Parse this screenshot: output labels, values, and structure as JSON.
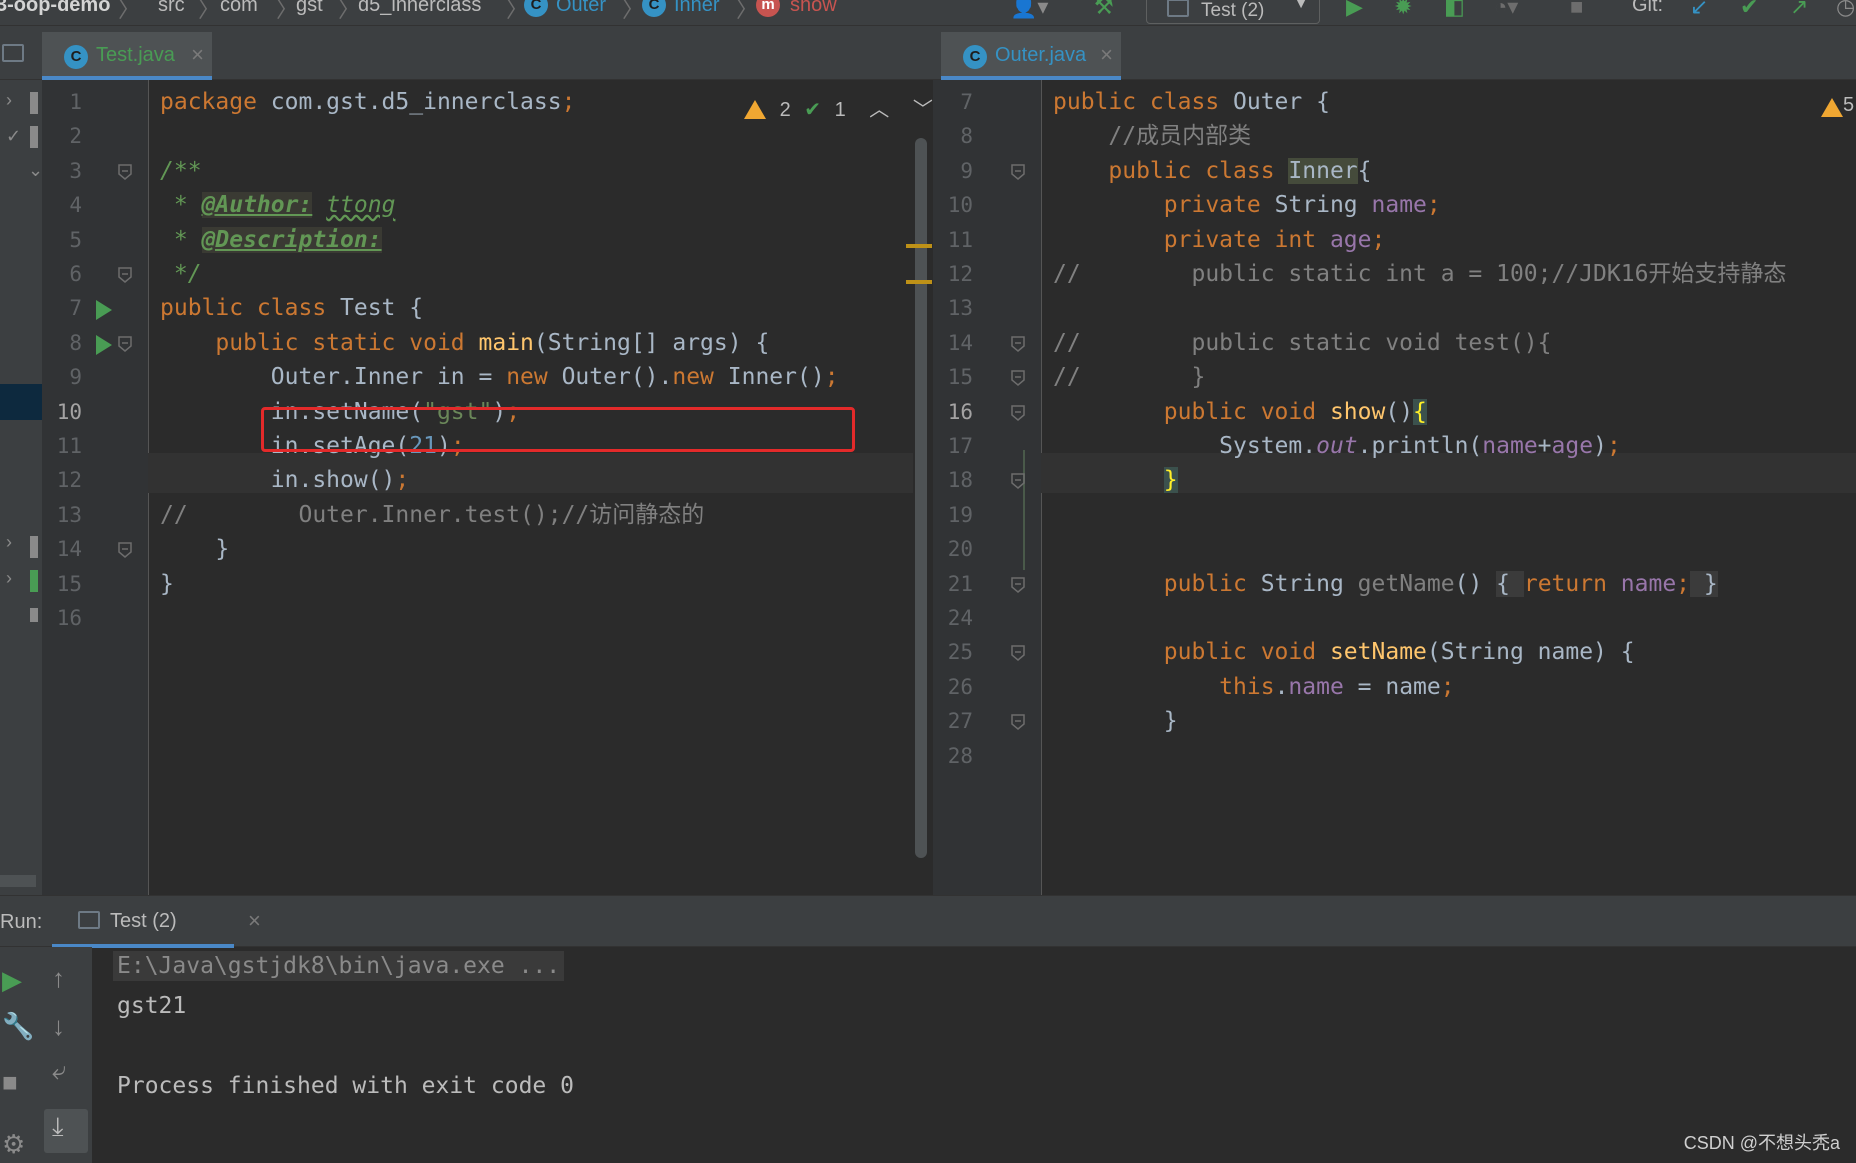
{
  "breadcrumbs": [
    "3-oop-demo",
    "src",
    "com",
    "gst",
    "d5_innerclass",
    "Outer",
    "Inner",
    "show"
  ],
  "toolbar": {
    "run_config": "Test (2)",
    "git_label": "Git:"
  },
  "left_tab": {
    "filename": "Test.java"
  },
  "right_tab": {
    "filename": "Outer.java"
  },
  "inspection": {
    "warnings": "2",
    "ok": "1"
  },
  "right_warnings": "5",
  "left_editor": {
    "line_numbers": [
      "1",
      "2",
      "3",
      "4",
      "5",
      "6",
      "7",
      "8",
      "9",
      "10",
      "11",
      "12",
      "13",
      "14",
      "15",
      "16"
    ],
    "current_line": "10",
    "lines": [
      [
        {
          "t": "package ",
          "c": "kw"
        },
        {
          "t": "com.gst.d5_innerclass",
          "c": ""
        },
        {
          "t": ";",
          "c": "kw"
        }
      ],
      [],
      [
        {
          "t": "/**",
          "c": "doc"
        }
      ],
      [
        {
          "t": " * ",
          "c": "doc"
        },
        {
          "t": "@Author:",
          "c": "dtag"
        },
        {
          "t": " ",
          "c": "doc"
        },
        {
          "t": "ttong",
          "c": "dval"
        }
      ],
      [
        {
          "t": " * ",
          "c": "doc"
        },
        {
          "t": "@Description:",
          "c": "dtag"
        }
      ],
      [
        {
          "t": " */",
          "c": "doc"
        }
      ],
      [
        {
          "t": "public class ",
          "c": "kw"
        },
        {
          "t": "Test {",
          "c": ""
        }
      ],
      [
        {
          "t": "    public static void ",
          "c": "kw"
        },
        {
          "t": "main",
          "c": "fn"
        },
        {
          "t": "(String[] args) {",
          "c": ""
        }
      ],
      [
        {
          "t": "        Outer.Inner in = ",
          "c": ""
        },
        {
          "t": "new ",
          "c": "kw"
        },
        {
          "t": "Outer().",
          "c": ""
        },
        {
          "t": "new ",
          "c": "kw"
        },
        {
          "t": "Inner()",
          "c": ""
        },
        {
          "t": ";",
          "c": "kw"
        }
      ],
      [
        {
          "t": "        in.setName(",
          "c": ""
        },
        {
          "t": "\"gst\"",
          "c": "str"
        },
        {
          "t": ")",
          "c": ""
        },
        {
          "t": ";",
          "c": "kw"
        }
      ],
      [
        {
          "t": "        in.setAge(",
          "c": ""
        },
        {
          "t": "21",
          "c": "num"
        },
        {
          "t": ")",
          "c": ""
        },
        {
          "t": ";",
          "c": "kw"
        }
      ],
      [
        {
          "t": "        in.show()",
          "c": ""
        },
        {
          "t": ";",
          "c": "kw"
        }
      ],
      [
        {
          "t": "//        Outer.Inner.test();//访问静态的",
          "c": "cmt"
        }
      ],
      [
        {
          "t": "    }",
          "c": ""
        }
      ],
      [
        {
          "t": "}",
          "c": ""
        }
      ],
      []
    ]
  },
  "right_editor": {
    "line_numbers": [
      "7",
      "8",
      "9",
      "10",
      "11",
      "12",
      "13",
      "14",
      "15",
      "16",
      "17",
      "18",
      "19",
      "20",
      "21",
      "24",
      "25",
      "26",
      "27",
      "28"
    ],
    "current_line": "16",
    "lines": [
      [
        {
          "t": "public class ",
          "c": "kw"
        },
        {
          "t": "Outer {",
          "c": ""
        }
      ],
      [
        {
          "t": "    //成员内部类",
          "c": "cmt"
        }
      ],
      [
        {
          "t": "    public class ",
          "c": "kw"
        },
        {
          "t": "Inner",
          "c": "inner-hl"
        },
        {
          "t": "{",
          "c": ""
        }
      ],
      [
        {
          "t": "        private ",
          "c": "kw"
        },
        {
          "t": "String ",
          "c": ""
        },
        {
          "t": "name",
          "c": "fld"
        },
        {
          "t": ";",
          "c": "kw"
        }
      ],
      [
        {
          "t": "        private int ",
          "c": "kw"
        },
        {
          "t": "age",
          "c": "fld"
        },
        {
          "t": ";",
          "c": "kw"
        }
      ],
      [
        {
          "t": "//        public static int a = 100;//JDK16开始支持静态",
          "c": "cmt"
        }
      ],
      [],
      [
        {
          "t": "//        public static void test(){",
          "c": "cmt"
        }
      ],
      [
        {
          "t": "//        }",
          "c": "cmt"
        }
      ],
      [
        {
          "t": "        public void ",
          "c": "kw"
        },
        {
          "t": "show",
          "c": "fn"
        },
        {
          "t": "()",
          "c": ""
        },
        {
          "t": "{",
          "c": "brace-hl"
        }
      ],
      [
        {
          "t": "            System.",
          "c": ""
        },
        {
          "t": "out",
          "c": "ital-fld"
        },
        {
          "t": ".println(",
          "c": ""
        },
        {
          "t": "name",
          "c": "fld"
        },
        {
          "t": "+",
          "c": ""
        },
        {
          "t": "age",
          "c": "fld"
        },
        {
          "t": ")",
          "c": ""
        },
        {
          "t": ";",
          "c": "kw"
        }
      ],
      [
        {
          "t": "        ",
          "c": ""
        },
        {
          "t": "}",
          "c": "brace-hl"
        }
      ],
      [],
      [],
      [
        {
          "t": "        public ",
          "c": "kw"
        },
        {
          "t": "String ",
          "c": ""
        },
        {
          "t": "getName",
          "c": "unused"
        },
        {
          "t": "() ",
          "c": ""
        },
        {
          "t": "{ ",
          "c": "hlbg"
        },
        {
          "t": "return ",
          "c": "kw"
        },
        {
          "t": "name",
          "c": "fld"
        },
        {
          "t": ";",
          "c": "kw"
        },
        {
          "t": " }",
          "c": "hlbg"
        }
      ],
      [],
      [
        {
          "t": "        public void ",
          "c": "kw"
        },
        {
          "t": "setName",
          "c": "fn"
        },
        {
          "t": "(String name) {",
          "c": ""
        }
      ],
      [
        {
          "t": "            this",
          "c": "kw"
        },
        {
          "t": ".",
          "c": ""
        },
        {
          "t": "name",
          "c": "fld"
        },
        {
          "t": " = name",
          "c": ""
        },
        {
          "t": ";",
          "c": "kw"
        }
      ],
      [
        {
          "t": "        }",
          "c": ""
        }
      ],
      []
    ]
  },
  "run_panel": {
    "label": "Run:",
    "tab_title": "Test (2)",
    "output": [
      "E:\\Java\\gstjdk8\\bin\\java.exe ...",
      "gst21",
      "",
      "Process finished with exit code 0"
    ]
  },
  "watermark": "CSDN @不想头秃a",
  "colors": {
    "accent": "#4a88c7",
    "keyword": "#cc7832",
    "string": "#6a8759",
    "number": "#6897bb",
    "field": "#9876aa",
    "method": "#ffc66d",
    "highlight_box": "#e32a2a"
  }
}
